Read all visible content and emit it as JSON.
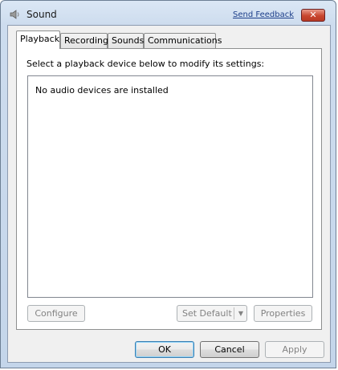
{
  "window": {
    "title": "Sound",
    "send_feedback": "Send Feedback",
    "close_glyph": "✕"
  },
  "tabs": [
    {
      "label": "Playback",
      "active": true
    },
    {
      "label": "Recording",
      "active": false
    },
    {
      "label": "Sounds",
      "active": false
    },
    {
      "label": "Communications",
      "active": false
    }
  ],
  "playback": {
    "instruction": "Select a playback device below to modify its settings:",
    "empty_message": "No audio devices are installed",
    "configure_label": "Configure",
    "set_default_label": "Set Default",
    "set_default_arrow": "▼",
    "properties_label": "Properties"
  },
  "footer": {
    "ok_label": "OK",
    "cancel_label": "Cancel",
    "apply_label": "Apply"
  }
}
